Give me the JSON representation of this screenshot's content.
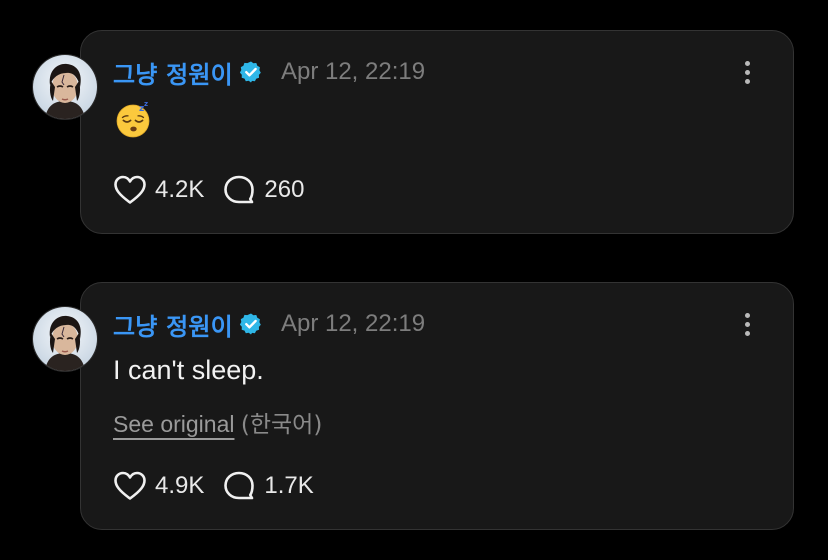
{
  "posts": [
    {
      "author": "그냥 정원이",
      "timestamp": "Apr 12, 22:19",
      "content_emoji": "sleeping-face",
      "likes": "4.2K",
      "comments": "260"
    },
    {
      "author": "그냥 정원이",
      "timestamp": "Apr 12, 22:19",
      "text": "I can't sleep.",
      "see_original_label": "See original",
      "original_language": "(한국어)",
      "likes": "4.9K",
      "comments": "1.7K"
    }
  ],
  "colors": {
    "background": "#000000",
    "card": "#181818",
    "card_border": "#333333",
    "username": "#3a96f5",
    "verified_badge": "#2fb7e8",
    "timestamp": "#7d7d7d"
  },
  "icons": {
    "verified": "verified-badge-icon",
    "like": "heart-outline-icon",
    "comment": "speech-bubble-outline-icon",
    "more": "vertical-ellipsis-icon"
  }
}
